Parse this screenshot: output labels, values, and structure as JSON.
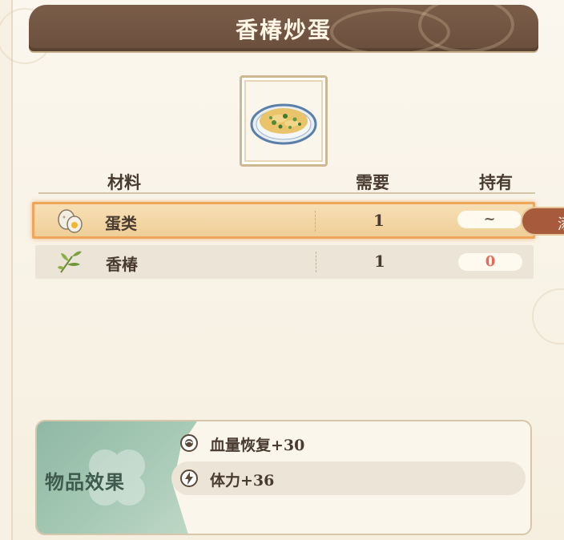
{
  "recipe": {
    "title": "香椿炒蛋",
    "dish_icon": "fried-egg-with-toon-dish"
  },
  "table": {
    "headers": {
      "material": "材料",
      "required": "需要",
      "owned": "持有"
    },
    "rows": [
      {
        "icon": "egg-icon",
        "name": "蛋类",
        "required": "1",
        "owned": "~",
        "selected": true
      },
      {
        "icon": "toon-leaves-icon",
        "name": "香椿",
        "required": "1",
        "owned": "0",
        "selected": false
      }
    ]
  },
  "side_tab": {
    "label": "添"
  },
  "effects": {
    "label": "物品效果",
    "items": [
      {
        "icon": "heart-restore-icon",
        "text": "血量恢复+30"
      },
      {
        "icon": "stamina-bolt-icon",
        "text": "体力+36"
      }
    ]
  },
  "colors": {
    "title_bar": "#6b4f3d",
    "selected_border": "#f0a65a",
    "owned_zero": "#e86a5a",
    "effect_accent": "#8fb8a4",
    "side_tab": "#a85a3c"
  }
}
